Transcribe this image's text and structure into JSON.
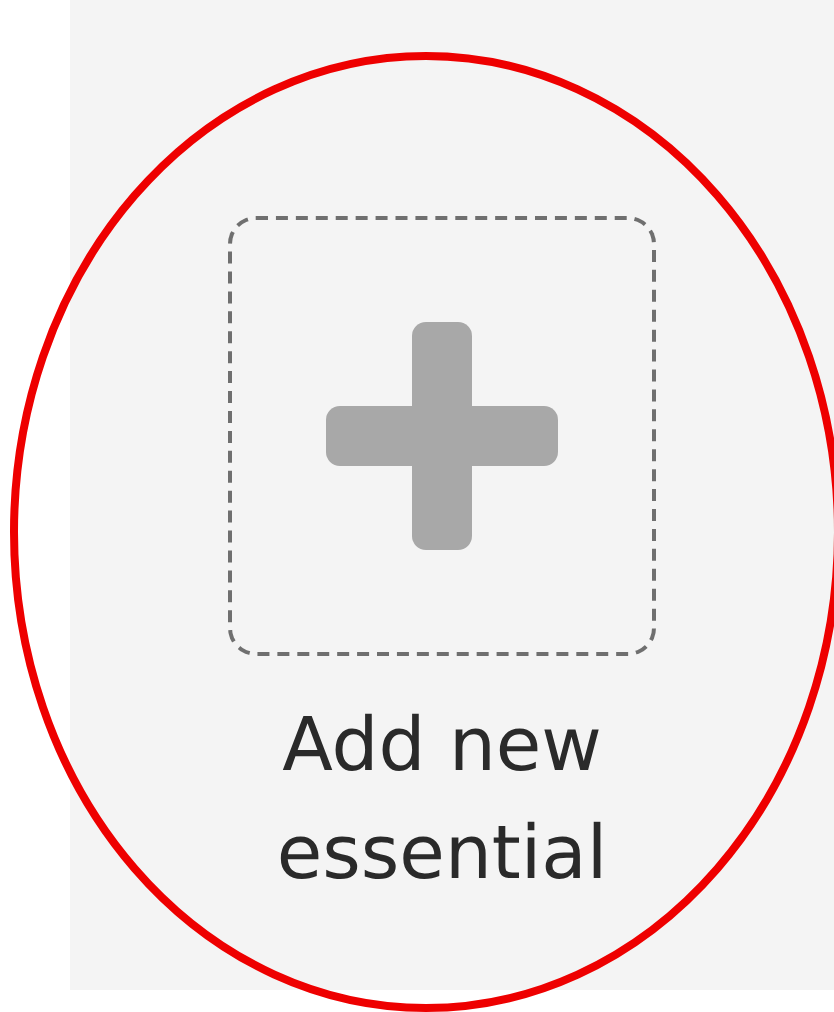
{
  "add_tile": {
    "label": "Add new essential"
  }
}
